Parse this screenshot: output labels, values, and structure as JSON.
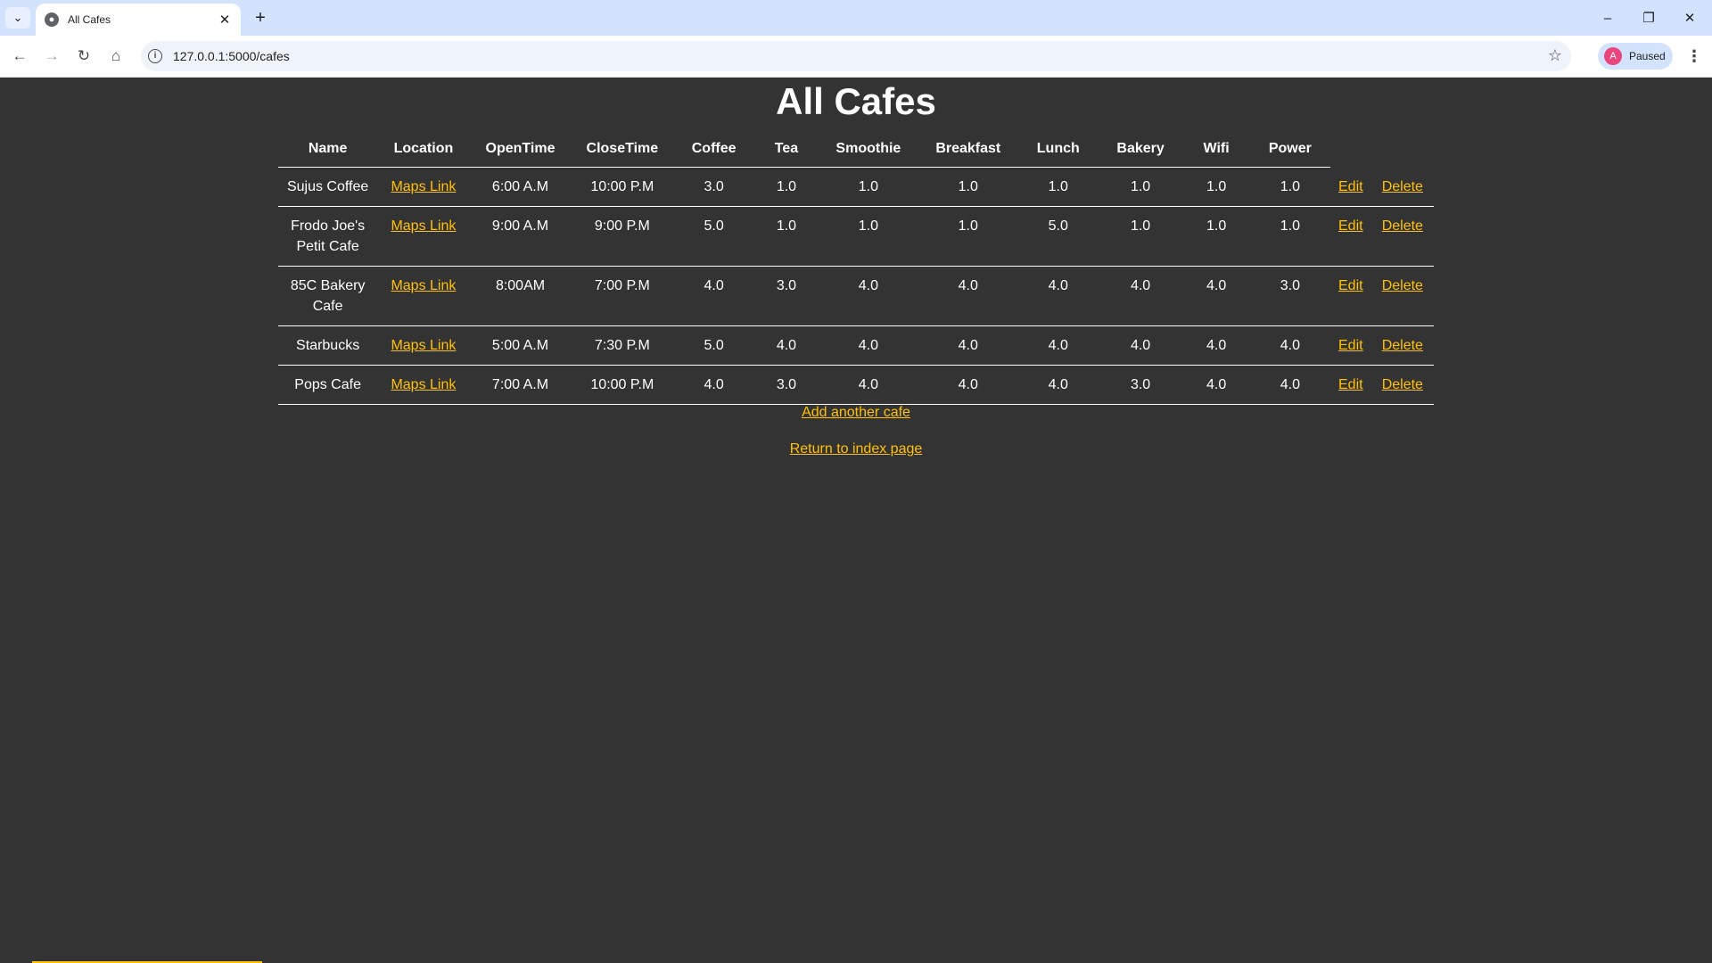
{
  "browser": {
    "tab_title": "All Cafes",
    "url": "127.0.0.1:5000/cafes",
    "profile_label": "Paused",
    "profile_initial": "A"
  },
  "page": {
    "title": "All Cafes",
    "columns": [
      "Name",
      "Location",
      "OpenTime",
      "CloseTime",
      "Coffee",
      "Tea",
      "Smoothie",
      "Breakfast",
      "Lunch",
      "Bakery",
      "Wifi",
      "Power"
    ],
    "rows": [
      {
        "name": "Sujus Coffee",
        "location": "Maps Link",
        "open": "6:00 A.M",
        "close": "10:00 P.M",
        "coffee": "3.0",
        "tea": "1.0",
        "smoothie": "1.0",
        "breakfast": "1.0",
        "lunch": "1.0",
        "bakery": "1.0",
        "wifi": "1.0",
        "power": "1.0",
        "edit": "Edit",
        "delete": "Delete"
      },
      {
        "name": "Frodo Joe's Petit Cafe",
        "location": "Maps Link",
        "open": "9:00 A.M",
        "close": "9:00 P.M",
        "coffee": "5.0",
        "tea": "1.0",
        "smoothie": "1.0",
        "breakfast": "1.0",
        "lunch": "5.0",
        "bakery": "1.0",
        "wifi": "1.0",
        "power": "1.0",
        "edit": "Edit",
        "delete": "Delete"
      },
      {
        "name": "85C Bakery Cafe",
        "location": "Maps Link",
        "open": "8:00AM",
        "close": "7:00 P.M",
        "coffee": "4.0",
        "tea": "3.0",
        "smoothie": "4.0",
        "breakfast": "4.0",
        "lunch": "4.0",
        "bakery": "4.0",
        "wifi": "4.0",
        "power": "3.0",
        "edit": "Edit",
        "delete": "Delete"
      },
      {
        "name": "Starbucks",
        "location": "Maps Link",
        "open": "5:00 A.M",
        "close": "7:30 P.M",
        "coffee": "5.0",
        "tea": "4.0",
        "smoothie": "4.0",
        "breakfast": "4.0",
        "lunch": "4.0",
        "bakery": "4.0",
        "wifi": "4.0",
        "power": "4.0",
        "edit": "Edit",
        "delete": "Delete"
      },
      {
        "name": "Pops Cafe",
        "location": "Maps Link",
        "open": "7:00 A.M",
        "close": "10:00 P.M",
        "coffee": "4.0",
        "tea": "3.0",
        "smoothie": "4.0",
        "breakfast": "4.0",
        "lunch": "4.0",
        "bakery": "3.0",
        "wifi": "4.0",
        "power": "4.0",
        "edit": "Edit",
        "delete": "Delete"
      }
    ],
    "add_link": "Add another cafe",
    "index_link": "Return to index page"
  },
  "colors": {
    "background": "#333333",
    "link": "#ffc107",
    "text": "#ffffff"
  }
}
